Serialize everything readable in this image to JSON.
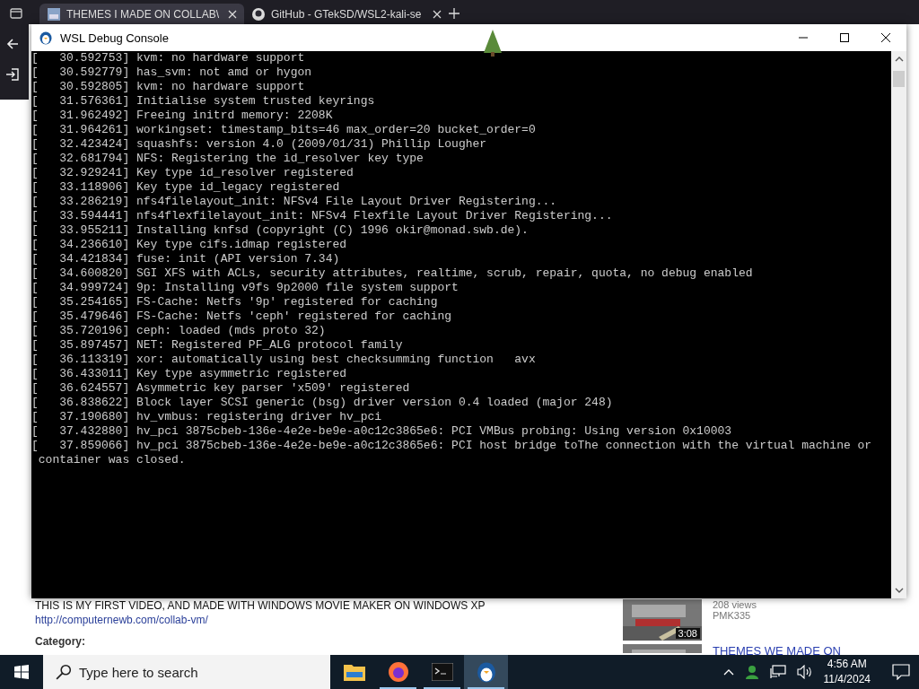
{
  "browser": {
    "tabs": [
      {
        "title": "THEMES I MADE ON COLLAB\\",
        "selected": true
      },
      {
        "title": "GitHub - GTekSD/WSL2-kali-se",
        "selected": false
      }
    ],
    "page": {
      "description": "THIS IS MY FIRST VIDEO, AND MADE WITH WINDOWS MOVIE MAKER ON WINDOWS XP",
      "link": "http://computernewb.com/collab-vm/",
      "category_label": "Category:",
      "related": [
        {
          "duration": "3:08",
          "views": "208 views",
          "author": "PMK335"
        },
        {
          "title": "THEMES WE MADE ON"
        }
      ]
    }
  },
  "console": {
    "title": "WSL Debug Console",
    "lines": [
      "[   30.592753] kvm: no hardware support",
      "[   30.592779] has_svm: not amd or hygon",
      "[   30.592805] kvm: no hardware support",
      "[   31.576361] Initialise system trusted keyrings",
      "[   31.962492] Freeing initrd memory: 2208K",
      "[   31.964261] workingset: timestamp_bits=46 max_order=20 bucket_order=0",
      "[   32.423424] squashfs: version 4.0 (2009/01/31) Phillip Lougher",
      "[   32.681794] NFS: Registering the id_resolver key type",
      "[   32.929241] Key type id_resolver registered",
      "[   33.118906] Key type id_legacy registered",
      "[   33.286219] nfs4filelayout_init: NFSv4 File Layout Driver Registering...",
      "[   33.594441] nfs4flexfilelayout_init: NFSv4 Flexfile Layout Driver Registering...",
      "[   33.955211] Installing knfsd (copyright (C) 1996 okir@monad.swb.de).",
      "[   34.236610] Key type cifs.idmap registered",
      "[   34.421834] fuse: init (API version 7.34)",
      "[   34.600820] SGI XFS with ACLs, security attributes, realtime, scrub, repair, quota, no debug enabled",
      "[   34.999724] 9p: Installing v9fs 9p2000 file system support",
      "[   35.254165] FS-Cache: Netfs '9p' registered for caching",
      "[   35.479646] FS-Cache: Netfs 'ceph' registered for caching",
      "[   35.720196] ceph: loaded (mds proto 32)",
      "[   35.897457] NET: Registered PF_ALG protocol family",
      "[   36.113319] xor: automatically using best checksumming function   avx",
      "[   36.433011] Key type asymmetric registered",
      "[   36.624557] Asymmetric key parser 'x509' registered",
      "[   36.838622] Block layer SCSI generic (bsg) driver version 0.4 loaded (major 248)",
      "[   37.190680] hv_vmbus: registering driver hv_pci",
      "[   37.432880] hv_pci 3875cbeb-136e-4e2e-be9e-a0c12c3865e6: PCI VMBus probing: Using version 0x10003",
      "[   37.859066] hv_pci 3875cbeb-136e-4e2e-be9e-a0c12c3865e6: PCI host bridge toThe connection with the virtual machine or",
      " container was closed."
    ]
  },
  "taskbar": {
    "search_placeholder": "Type here to search",
    "apps": [
      {
        "kind": "folder",
        "running": false,
        "selected": false
      },
      {
        "kind": "firefox",
        "running": true,
        "selected": false
      },
      {
        "kind": "terminal",
        "running": true,
        "selected": false
      },
      {
        "kind": "penguin",
        "running": true,
        "selected": true
      }
    ],
    "time": "4:56 AM",
    "date": "11/4/2024"
  }
}
